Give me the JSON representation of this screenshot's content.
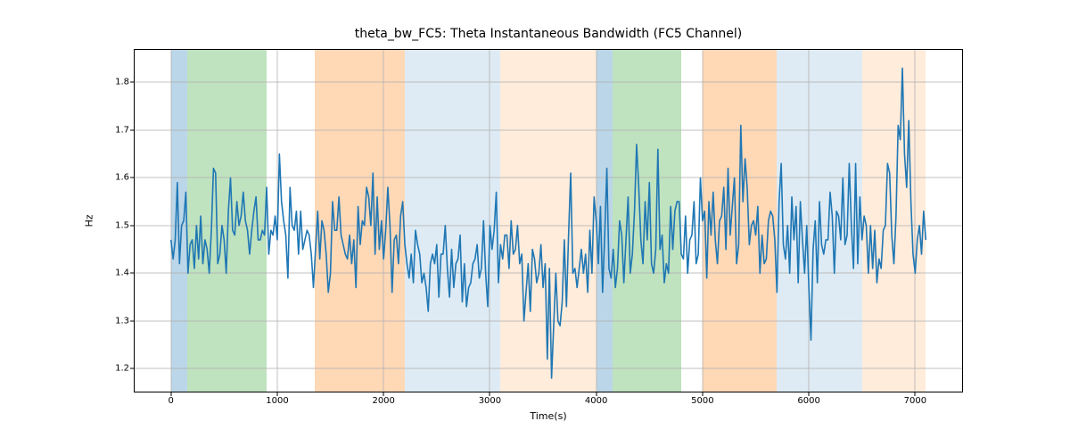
{
  "chart_data": {
    "type": "line",
    "title": "theta_bw_FC5: Theta Instantaneous Bandwidth (FC5 Channel)",
    "xlabel": "Time(s)",
    "ylabel": "Hz",
    "xlim": [
      -350,
      7450
    ],
    "ylim": [
      1.15,
      1.87
    ],
    "xticks": [
      0,
      1000,
      2000,
      3000,
      4000,
      5000,
      6000,
      7000
    ],
    "yticks": [
      1.2,
      1.3,
      1.4,
      1.5,
      1.6,
      1.7,
      1.8
    ],
    "line_color": "#1f77b4",
    "span_regions": [
      {
        "start": 0,
        "end": 150,
        "color": "#1f77b4",
        "alpha": 0.3
      },
      {
        "start": 150,
        "end": 900,
        "color": "#2ca02c",
        "alpha": 0.3
      },
      {
        "start": 1350,
        "end": 2200,
        "color": "#ff7f0e",
        "alpha": 0.3
      },
      {
        "start": 2200,
        "end": 3100,
        "color": "#1f77b4",
        "alpha": 0.15
      },
      {
        "start": 3100,
        "end": 4000,
        "color": "#ff7f0e",
        "alpha": 0.15
      },
      {
        "start": 4000,
        "end": 4150,
        "color": "#1f77b4",
        "alpha": 0.3
      },
      {
        "start": 4150,
        "end": 4800,
        "color": "#2ca02c",
        "alpha": 0.3
      },
      {
        "start": 5000,
        "end": 5700,
        "color": "#ff7f0e",
        "alpha": 0.3
      },
      {
        "start": 5700,
        "end": 6500,
        "color": "#1f77b4",
        "alpha": 0.15
      },
      {
        "start": 6500,
        "end": 7100,
        "color": "#ff7f0e",
        "alpha": 0.15
      }
    ],
    "series": [
      {
        "name": "theta_bw_FC5",
        "x_start": 0,
        "x_step": 20,
        "y": [
          1.47,
          1.43,
          1.47,
          1.59,
          1.42,
          1.5,
          1.51,
          1.57,
          1.4,
          1.46,
          1.47,
          1.41,
          1.5,
          1.43,
          1.52,
          1.42,
          1.47,
          1.45,
          1.4,
          1.49,
          1.62,
          1.61,
          1.42,
          1.44,
          1.5,
          1.47,
          1.4,
          1.53,
          1.6,
          1.49,
          1.48,
          1.55,
          1.5,
          1.52,
          1.57,
          1.51,
          1.49,
          1.44,
          1.49,
          1.53,
          1.56,
          1.47,
          1.47,
          1.49,
          1.48,
          1.58,
          1.44,
          1.49,
          1.48,
          1.52,
          1.47,
          1.65,
          1.55,
          1.51,
          1.48,
          1.39,
          1.58,
          1.5,
          1.49,
          1.53,
          1.44,
          1.53,
          1.45,
          1.47,
          1.49,
          1.48,
          1.44,
          1.37,
          1.45,
          1.53,
          1.43,
          1.51,
          1.49,
          1.44,
          1.36,
          1.4,
          1.55,
          1.49,
          1.49,
          1.56,
          1.48,
          1.46,
          1.44,
          1.43,
          1.48,
          1.42,
          1.47,
          1.37,
          1.54,
          1.46,
          1.51,
          1.5,
          1.58,
          1.56,
          1.5,
          1.61,
          1.44,
          1.56,
          1.45,
          1.51,
          1.43,
          1.49,
          1.58,
          1.5,
          1.36,
          1.47,
          1.48,
          1.42,
          1.52,
          1.55,
          1.46,
          1.42,
          1.39,
          1.44,
          1.38,
          1.49,
          1.46,
          1.44,
          1.38,
          1.4,
          1.37,
          1.32,
          1.42,
          1.44,
          1.42,
          1.46,
          1.35,
          1.44,
          1.44,
          1.5,
          1.41,
          1.35,
          1.45,
          1.37,
          1.42,
          1.43,
          1.48,
          1.34,
          1.42,
          1.33,
          1.37,
          1.38,
          1.42,
          1.43,
          1.46,
          1.39,
          1.41,
          1.51,
          1.4,
          1.33,
          1.5,
          1.45,
          1.49,
          1.57,
          1.38,
          1.46,
          1.43,
          1.48,
          1.48,
          1.41,
          1.51,
          1.44,
          1.45,
          1.5,
          1.42,
          1.44,
          1.3,
          1.36,
          1.42,
          1.32,
          1.45,
          1.43,
          1.38,
          1.4,
          1.46,
          1.37,
          1.42,
          1.22,
          1.41,
          1.18,
          1.29,
          1.4,
          1.3,
          1.29,
          1.34,
          1.47,
          1.33,
          1.48,
          1.61,
          1.4,
          1.41,
          1.37,
          1.41,
          1.45,
          1.4,
          1.44,
          1.36,
          1.49,
          1.4,
          1.56,
          1.51,
          1.42,
          1.54,
          1.36,
          1.48,
          1.62,
          1.41,
          1.39,
          1.45,
          1.37,
          1.41,
          1.51,
          1.48,
          1.38,
          1.47,
          1.56,
          1.4,
          1.44,
          1.53,
          1.67,
          1.58,
          1.47,
          1.42,
          1.55,
          1.47,
          1.59,
          1.42,
          1.4,
          1.45,
          1.66,
          1.45,
          1.48,
          1.38,
          1.42,
          1.4,
          1.54,
          1.45,
          1.53,
          1.55,
          1.55,
          1.44,
          1.43,
          1.52,
          1.4,
          1.47,
          1.48,
          1.55,
          1.42,
          1.44,
          1.6,
          1.51,
          1.53,
          1.39,
          1.55,
          1.48,
          1.57,
          1.47,
          1.42,
          1.51,
          1.52,
          1.58,
          1.45,
          1.62,
          1.48,
          1.54,
          1.6,
          1.42,
          1.46,
          1.71,
          1.55,
          1.64,
          1.58,
          1.46,
          1.5,
          1.51,
          1.48,
          1.54,
          1.4,
          1.48,
          1.42,
          1.43,
          1.51,
          1.53,
          1.52,
          1.47,
          1.36,
          1.55,
          1.63,
          1.46,
          1.43,
          1.5,
          1.4,
          1.56,
          1.47,
          1.54,
          1.38,
          1.55,
          1.47,
          1.4,
          1.5,
          1.37,
          1.26,
          1.45,
          1.51,
          1.38,
          1.55,
          1.46,
          1.44,
          1.47,
          1.47,
          1.57,
          1.52,
          1.4,
          1.53,
          1.52,
          1.47,
          1.6,
          1.46,
          1.48,
          1.63,
          1.5,
          1.41,
          1.63,
          1.42,
          1.56,
          1.47,
          1.52,
          1.5,
          1.4,
          1.5,
          1.41,
          1.49,
          1.38,
          1.43,
          1.41,
          1.49,
          1.5,
          1.63,
          1.61,
          1.48,
          1.42,
          1.52,
          1.71,
          1.68,
          1.83,
          1.65,
          1.58,
          1.72,
          1.55,
          1.44,
          1.4,
          1.47,
          1.5,
          1.44,
          1.53,
          1.47
        ]
      }
    ]
  }
}
